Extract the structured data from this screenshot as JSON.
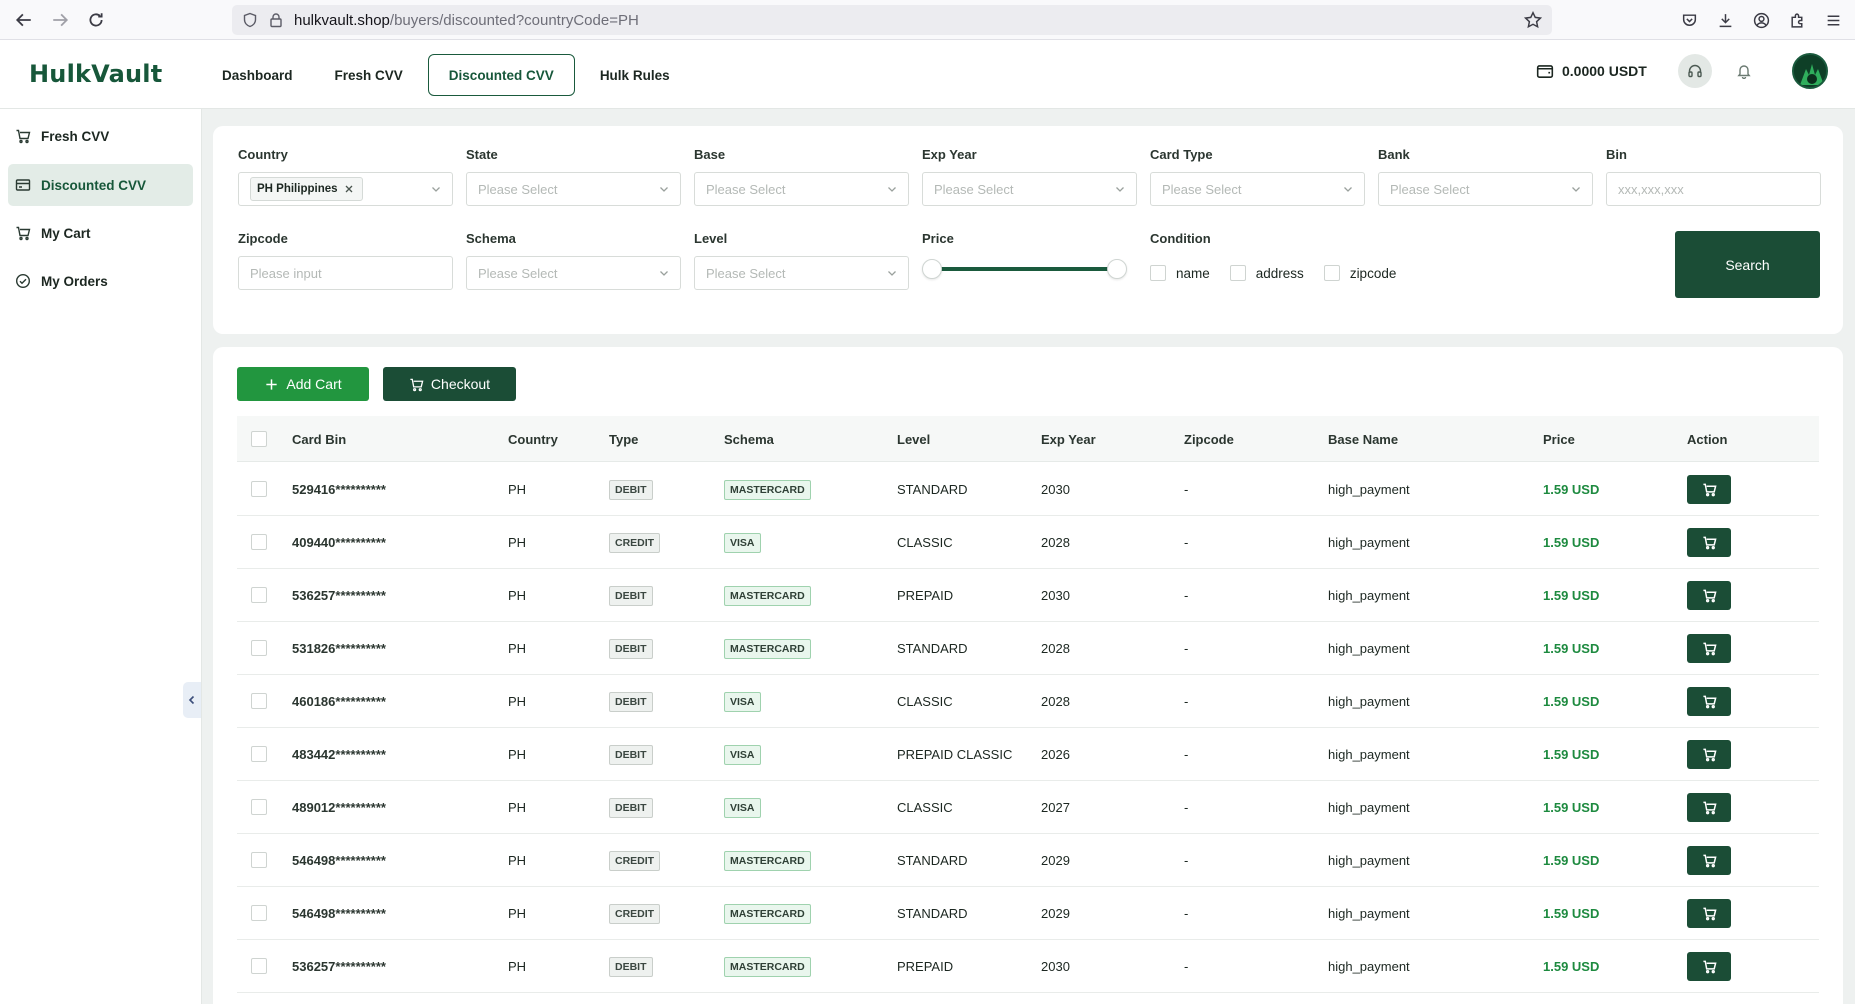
{
  "browser": {
    "url_host": "hulkvault.shop",
    "url_path": "/buyers/discounted?countryCode=PH"
  },
  "header": {
    "logo": "HulkVault",
    "nav": [
      {
        "label": "Dashboard",
        "active": false
      },
      {
        "label": "Fresh CVV",
        "active": false
      },
      {
        "label": "Discounted CVV",
        "active": true
      },
      {
        "label": "Hulk Rules",
        "active": false
      }
    ],
    "wallet": "0.0000 USDT"
  },
  "sidebar": {
    "items": [
      {
        "label": "Fresh CVV",
        "icon": "cart-list-icon",
        "active": false
      },
      {
        "label": "Discounted CVV",
        "icon": "card-icon",
        "active": true
      },
      {
        "label": "My Cart",
        "icon": "cart-icon",
        "active": false
      },
      {
        "label": "My Orders",
        "icon": "check-circle-icon",
        "active": false
      }
    ]
  },
  "filters": {
    "country_label": "Country",
    "country_tag": "PH Philippines",
    "state_label": "State",
    "state_placeholder": "Please Select",
    "base_label": "Base",
    "base_placeholder": "Please Select",
    "exp_label": "Exp Year",
    "exp_placeholder": "Please Select",
    "cardtype_label": "Card Type",
    "cardtype_placeholder": "Please Select",
    "bank_label": "Bank",
    "bank_placeholder": "Please Select",
    "bin_label": "Bin",
    "bin_placeholder": "xxx,xxx,xxx",
    "zipcode_label": "Zipcode",
    "zipcode_placeholder": "Please input",
    "schema_label": "Schema",
    "schema_placeholder": "Please Select",
    "level_label": "Level",
    "level_placeholder": "Please Select",
    "price_label": "Price",
    "condition_label": "Condition",
    "conditions": [
      "name",
      "address",
      "zipcode"
    ],
    "search_label": "Search"
  },
  "actions": {
    "add_cart": "Add Cart",
    "checkout": "Checkout"
  },
  "table": {
    "columns": [
      "Card Bin",
      "Country",
      "Type",
      "Schema",
      "Level",
      "Exp Year",
      "Zipcode",
      "Base Name",
      "Price",
      "Action"
    ],
    "rows": [
      {
        "bin": "529416**********",
        "country": "PH",
        "type": "DEBIT",
        "schema": "MASTERCARD",
        "level": "STANDARD",
        "exp": "2030",
        "zip": "-",
        "base": "high_payment",
        "price": "1.59 USD"
      },
      {
        "bin": "409440**********",
        "country": "PH",
        "type": "CREDIT",
        "schema": "VISA",
        "level": "CLASSIC",
        "exp": "2028",
        "zip": "-",
        "base": "high_payment",
        "price": "1.59 USD"
      },
      {
        "bin": "536257**********",
        "country": "PH",
        "type": "DEBIT",
        "schema": "MASTERCARD",
        "level": "PREPAID",
        "exp": "2030",
        "zip": "-",
        "base": "high_payment",
        "price": "1.59 USD"
      },
      {
        "bin": "531826**********",
        "country": "PH",
        "type": "DEBIT",
        "schema": "MASTERCARD",
        "level": "STANDARD",
        "exp": "2028",
        "zip": "-",
        "base": "high_payment",
        "price": "1.59 USD"
      },
      {
        "bin": "460186**********",
        "country": "PH",
        "type": "DEBIT",
        "schema": "VISA",
        "level": "CLASSIC",
        "exp": "2028",
        "zip": "-",
        "base": "high_payment",
        "price": "1.59 USD"
      },
      {
        "bin": "483442**********",
        "country": "PH",
        "type": "DEBIT",
        "schema": "VISA",
        "level": "PREPAID CLASSIC",
        "exp": "2026",
        "zip": "-",
        "base": "high_payment",
        "price": "1.59 USD"
      },
      {
        "bin": "489012**********",
        "country": "PH",
        "type": "DEBIT",
        "schema": "VISA",
        "level": "CLASSIC",
        "exp": "2027",
        "zip": "-",
        "base": "high_payment",
        "price": "1.59 USD"
      },
      {
        "bin": "546498**********",
        "country": "PH",
        "type": "CREDIT",
        "schema": "MASTERCARD",
        "level": "STANDARD",
        "exp": "2029",
        "zip": "-",
        "base": "high_payment",
        "price": "1.59 USD"
      },
      {
        "bin": "546498**********",
        "country": "PH",
        "type": "CREDIT",
        "schema": "MASTERCARD",
        "level": "STANDARD",
        "exp": "2029",
        "zip": "-",
        "base": "high_payment",
        "price": "1.59 USD"
      },
      {
        "bin": "536257**********",
        "country": "PH",
        "type": "DEBIT",
        "schema": "MASTERCARD",
        "level": "PREPAID",
        "exp": "2030",
        "zip": "-",
        "base": "high_payment",
        "price": "1.59 USD"
      }
    ]
  },
  "colors": {
    "brand": "#17573a",
    "button_dark": "#1b4d36",
    "button_green": "#22963f",
    "price": "#1d8a3f"
  }
}
